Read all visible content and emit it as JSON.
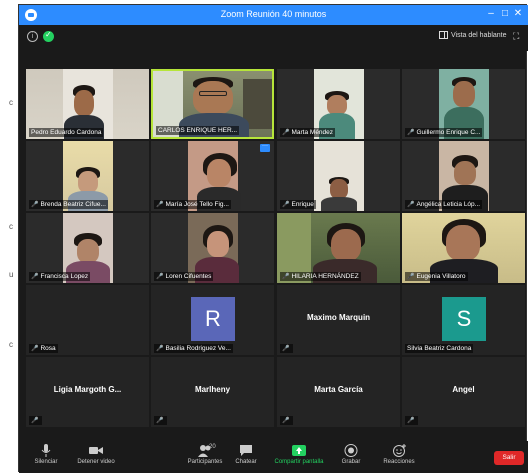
{
  "window": {
    "title": "Zoom Reunión 40 minutos",
    "minimize": "–",
    "maximize": "□",
    "close": "✕"
  },
  "topbar": {
    "info": "i",
    "view_label": "Vista del hablante",
    "fullscreen": "⛶"
  },
  "tiles": [
    {
      "name": "Pedro Eduardo Cardona",
      "muted": false,
      "video": true
    },
    {
      "name": "CARLOS ENRIQUE HER...",
      "muted": false,
      "video": true,
      "active": true
    },
    {
      "name": "Marta Méndez",
      "muted": true,
      "video": true
    },
    {
      "name": "Guillermo Enrique C...",
      "muted": true,
      "video": true
    },
    {
      "name": "Brenda Beatriz Cifue...",
      "muted": true,
      "video": true
    },
    {
      "name": "María José Tello Fig...",
      "muted": true,
      "video": true,
      "more": "···"
    },
    {
      "name": "Enrique",
      "muted": true,
      "video": true
    },
    {
      "name": "Angélica Leticia Lóp...",
      "muted": true,
      "video": true
    },
    {
      "name": "Francisca Lopez",
      "muted": true,
      "video": true
    },
    {
      "name": "Loren Cifuentes",
      "muted": true,
      "video": true
    },
    {
      "name": "HILARIA HERNÁNDEZ",
      "muted": true,
      "video": true
    },
    {
      "name": "Eugenia Villatoro",
      "muted": true,
      "video": true
    },
    {
      "name": "Rosa",
      "muted": true,
      "video": false
    },
    {
      "name": "Basilia Rodriguez Ve...",
      "muted": true,
      "video": false,
      "initial": "R",
      "initial_color": "#5a67b8"
    },
    {
      "name": "",
      "muted": true,
      "video": false,
      "center": "Maximo Marquin"
    },
    {
      "name": "Silvia Beatriz Cardona",
      "muted": false,
      "video": false,
      "initial": "S",
      "initial_color": "#1b9a8e"
    },
    {
      "name": "",
      "muted": true,
      "video": false,
      "center": "Ligia Margoth G..."
    },
    {
      "name": "",
      "muted": true,
      "video": false,
      "center": "Marlheny"
    },
    {
      "name": "",
      "muted": true,
      "video": false,
      "center": "Marta García"
    },
    {
      "name": "",
      "muted": true,
      "video": false,
      "center": "Angel"
    }
  ],
  "toolbar": {
    "mute_label": "Silenciar",
    "video_label": "Detener video",
    "participants_label": "Participantes",
    "participants_count": "20",
    "chat_label": "Chatear",
    "share_label": "Compartir pantalla",
    "record_label": "Grabar",
    "reactions_label": "Reacciones",
    "leave_label": "Salir"
  },
  "colors": {
    "titlebar": "#2d8cff",
    "active_speaker": "#b6e53a",
    "leave": "#e02828",
    "share": "#23d160"
  }
}
